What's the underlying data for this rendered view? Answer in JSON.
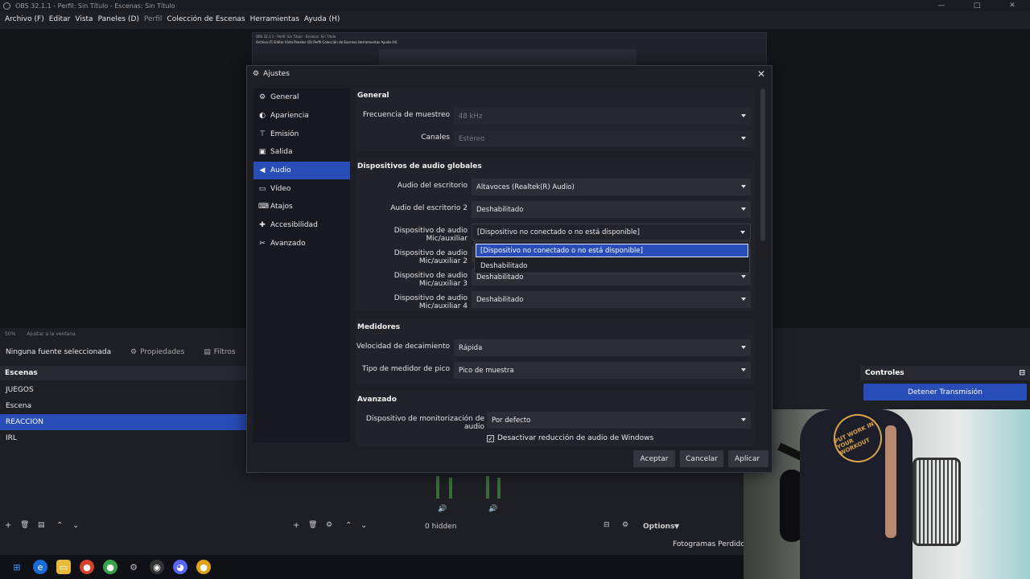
{
  "window": {
    "title": "OBS 32.1.1 - Perfil: Sin Título - Escenas: Sin Título",
    "controls": {
      "minimize": "—",
      "maximize": "□",
      "close": "✕"
    }
  },
  "menubar": [
    "Archivo (F)",
    "Editar",
    "Vista",
    "Paneles (D)",
    "Perfil",
    "Colección de Escenas",
    "Herramientas",
    "Ayuda (H)"
  ],
  "preview": {
    "inner_title": "OBS 32.1.1 - Perfil: Sin Título - Escenas: Sin Título",
    "inner_menu": "Archivo (F)   Editar   Vista   Paneles (D)   Perfil   Colección de Escenas   Herramientas   Ayuda (H)",
    "zoom": "50%",
    "fit": "Ajustar a la ventana"
  },
  "source_toolbar": {
    "no_source": "Ninguna fuente seleccionada",
    "properties": "Propiedades",
    "filters": "Filtros"
  },
  "scenes": {
    "title": "Escenas",
    "items": [
      "JUEGOS",
      "Escena",
      "REACCION",
      "IRL"
    ],
    "selected": "REACCION"
  },
  "sources": {
    "hidden_count": "0 hidden",
    "options": "Options"
  },
  "controls": {
    "title": "Controles",
    "stop_stream": "Detener Transmisión"
  },
  "status": {
    "dropped_frames": "Fotogramas Perdidos"
  },
  "camera": {
    "shirt_text": "PUT WORK IN YOUR WORKOUT"
  },
  "dialog": {
    "title": "Ajustes",
    "nav": [
      {
        "label": "General",
        "icon": "gear-icon",
        "glyph": "⚙"
      },
      {
        "label": "Apariencia",
        "icon": "appearance-icon",
        "glyph": "◐"
      },
      {
        "label": "Emisión",
        "icon": "antenna-icon",
        "glyph": "⊤"
      },
      {
        "label": "Salida",
        "icon": "output-icon",
        "glyph": "▣"
      },
      {
        "label": "Audio",
        "icon": "speaker-icon",
        "glyph": "◀"
      },
      {
        "label": "Vídeo",
        "icon": "monitor-icon",
        "glyph": "▭"
      },
      {
        "label": "Atajos",
        "icon": "keyboard-icon",
        "glyph": "⌨"
      },
      {
        "label": "Accesibilidad",
        "icon": "accessibility-icon",
        "glyph": "✚"
      },
      {
        "label": "Avanzado",
        "icon": "tools-icon",
        "glyph": "✂"
      }
    ],
    "selected_nav": "Audio",
    "general": {
      "title": "General",
      "sample_rate_label": "Frecuencia de muestreo",
      "sample_rate": "48 kHz",
      "channels_label": "Canales",
      "channels": "Estéreo"
    },
    "global_devices": {
      "title": "Dispositivos de audio globales",
      "rows": [
        {
          "label": "Audio del escritorio",
          "value": "Altavoces (Realtek(R) Audio)"
        },
        {
          "label": "Audio del escritorio 2",
          "value": "Deshabilitado"
        },
        {
          "label": "Dispositivo de audio Mic/auxiliar",
          "value": "[Dispositivo no conectado o no está disponible]"
        },
        {
          "label": "Dispositivo de audio Mic/auxiliar 2",
          "value": ""
        },
        {
          "label": "Dispositivo de audio Mic/auxiliar 3",
          "value": "Deshabilitado"
        },
        {
          "label": "Dispositivo de audio Mic/auxiliar 4",
          "value": "Deshabilitado"
        }
      ]
    },
    "dropdown_options": [
      "[Dispositivo no conectado o no está disponible]",
      "Deshabilitado"
    ],
    "meters": {
      "title": "Medidores",
      "decay_label": "Velocidad de decaimiento",
      "decay": "Rápida",
      "peak_label": "Tipo de medidor de pico",
      "peak": "Pico de muestra"
    },
    "advanced": {
      "title": "Avanzado",
      "monitor_label": "Dispositivo de monitorización de audio",
      "monitor": "Por defecto",
      "ducking_label": "Desactivar reducción de audio de Windows",
      "ducking_checked": true
    },
    "buttons": {
      "accept": "Aceptar",
      "cancel": "Cancelar",
      "apply": "Aplicar"
    }
  }
}
